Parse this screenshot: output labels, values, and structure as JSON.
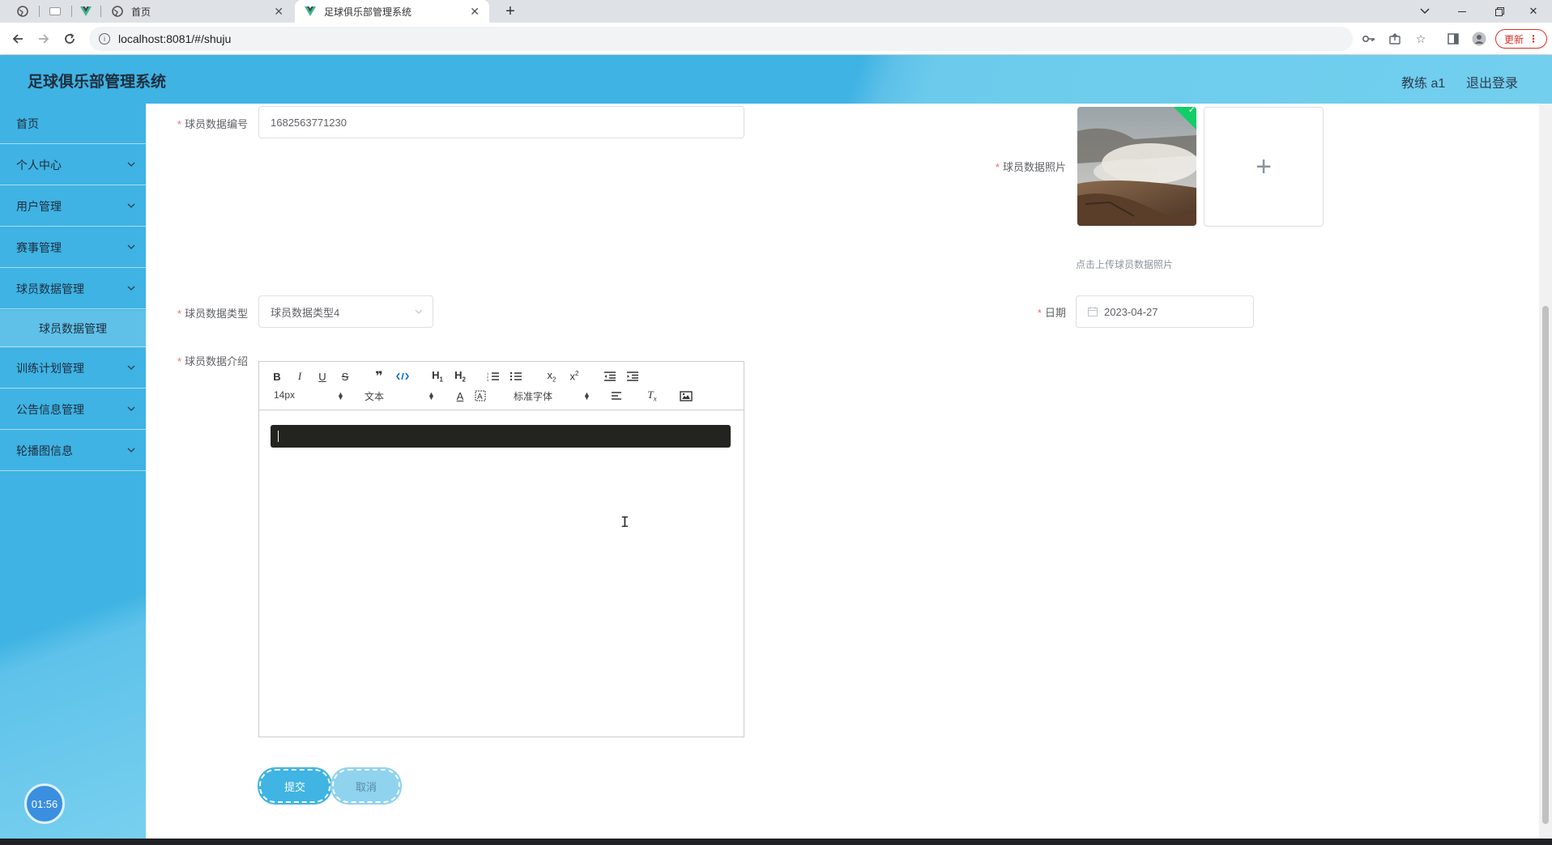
{
  "browser": {
    "tabs": [
      {
        "title": "首页",
        "active": false
      },
      {
        "title": "足球俱乐部管理系统",
        "active": true
      }
    ],
    "url": "localhost:8081/#/shuju",
    "update_label": "更新"
  },
  "header": {
    "title": "足球俱乐部管理系统",
    "user": "教练 a1",
    "logout": "退出登录"
  },
  "sidebar": {
    "items": [
      {
        "label": "首页",
        "has_children": false
      },
      {
        "label": "个人中心",
        "has_children": true
      },
      {
        "label": "用户管理",
        "has_children": true
      },
      {
        "label": "赛事管理",
        "has_children": true
      },
      {
        "label": "球员数据管理",
        "has_children": true
      },
      {
        "label": "球员数据管理",
        "has_children": false
      },
      {
        "label": "训练计划管理",
        "has_children": true
      },
      {
        "label": "公告信息管理",
        "has_children": true
      },
      {
        "label": "轮播图信息",
        "has_children": true
      }
    ],
    "timer": "01:56"
  },
  "form": {
    "number_label": "球员数据编号",
    "number_value": "1682563771230",
    "photo_label": "球员数据照片",
    "photo_tip": "点击上传球员数据照片",
    "type_label": "球员数据类型",
    "type_value": "球员数据类型4",
    "date_label": "日期",
    "date_value": "2023-04-27",
    "intro_label": "球员数据介绍",
    "required_mark": "*"
  },
  "editor": {
    "font_size": "14px",
    "header_select": "文本",
    "font_family": "标准字体",
    "h1": "H",
    "h2": "H"
  },
  "buttons": {
    "submit": "提交",
    "cancel": "取消"
  },
  "colors": {
    "primary": "#3fb3e3",
    "required": "#f56c6c",
    "success": "#13ce66"
  }
}
